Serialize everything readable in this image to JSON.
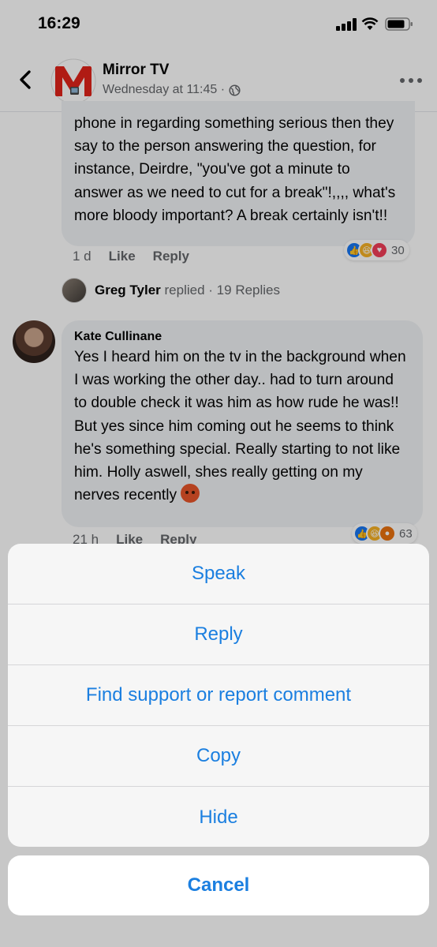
{
  "status_bar": {
    "time": "16:29"
  },
  "header": {
    "page_name": "Mirror TV",
    "post_time": "Wednesday at 11:45 ·"
  },
  "comments": [
    {
      "text": "phone in regarding something serious then they say to the person answering the question, for instance, Deirdre, \"you've got a minute to answer as we need to cut for a break\"!,,,, what's more bloody important? A break certainly isn't!!",
      "age": "1 d",
      "like_label": "Like",
      "reply_label": "Reply",
      "reaction_count": "30",
      "reactions": [
        "like",
        "haha",
        "love"
      ],
      "replies_summary": {
        "name": "Greg Tyler",
        "verb": "replied",
        "count_text": "· 19 Replies"
      }
    },
    {
      "author": "Kate Cullinane",
      "text": "Yes I heard him on the tv in the background when I was working the other day.. had to turn around to double check it was him as how rude he was!! But yes since him coming out he seems to think he's something special. Really starting to not like him. Holly aswell, shes really getting on my nerves recently",
      "age": "21 h",
      "like_label": "Like",
      "reply_label": "Reply",
      "reaction_count": "63",
      "reactions": [
        "like",
        "haha",
        "angry"
      ]
    }
  ],
  "action_sheet": {
    "items": [
      "Speak",
      "Reply",
      "Find support or report comment",
      "Copy",
      "Hide"
    ],
    "cancel_label": "Cancel"
  },
  "colors": {
    "accent": "#1b7fe0",
    "like": "#1877f2",
    "haha": "#f7b125",
    "love": "#f33e58",
    "angry": "#e9710f"
  }
}
